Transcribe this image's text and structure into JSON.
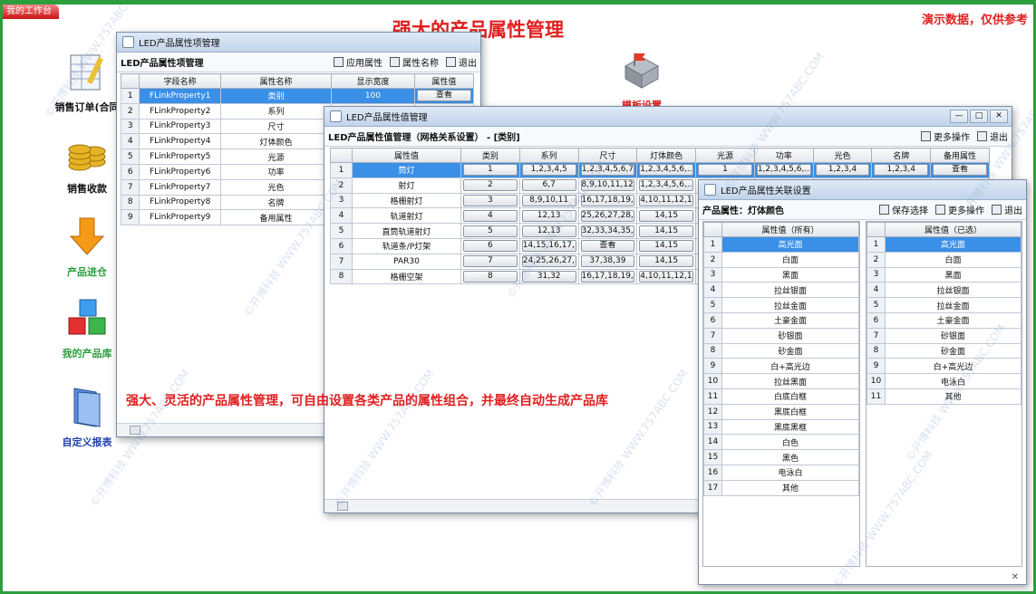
{
  "app": {
    "tab_label": "我的工作台",
    "headline": "强大的产品属性管理",
    "demo_note": "演示数据，仅供参考",
    "tagline": "强大、灵活的产品属性管理，可自由设置各类产品的属性组合，并最终自动生成产品库",
    "watermark": "©开博科技 WWW.757ABC.COM"
  },
  "sidebar": {
    "items": [
      {
        "label": "销售订单(合同",
        "icon": "spreadsheet-pencil-icon"
      },
      {
        "label": "销售收款",
        "icon": "coins-icon"
      },
      {
        "label": "产品进仓",
        "icon": "down-arrow-icon"
      },
      {
        "label": "我的产品库",
        "icon": "cubes-icon"
      },
      {
        "label": "自定义报表",
        "icon": "folder-icon"
      }
    ]
  },
  "desktop": {
    "partial_label": "模板设置",
    "icon": "flag-blocks-icon"
  },
  "win1": {
    "title": "LED产品属性项管理",
    "toolbar_label": "LED产品属性项管理",
    "actions": [
      "应用属性",
      "属性名称",
      "退出"
    ],
    "columns": [
      "字段名称",
      "属性名称",
      "显示宽度",
      "属性值"
    ],
    "rows": [
      [
        "FLinkProperty1",
        "类别",
        "100",
        "查看"
      ],
      [
        "FLinkProperty2",
        "系列",
        "",
        ""
      ],
      [
        "FLinkProperty3",
        "尺寸",
        "",
        ""
      ],
      [
        "FLinkProperty4",
        "灯体颜色",
        "",
        ""
      ],
      [
        "FLinkProperty5",
        "光源",
        "",
        ""
      ],
      [
        "FLinkProperty6",
        "功率",
        "",
        ""
      ],
      [
        "FLinkProperty7",
        "光色",
        "",
        ""
      ],
      [
        "FLinkProperty8",
        "名牌",
        "",
        ""
      ],
      [
        "FLinkProperty9",
        "备用属性",
        "",
        ""
      ]
    ]
  },
  "win2": {
    "title": "LED产品属性值管理",
    "toolbar_label": "LED产品属性值管理（网格关系设置） - [类别]",
    "actions": [
      "更多操作",
      "退出"
    ],
    "columns": [
      "属性值",
      "类别",
      "系列",
      "尺寸",
      "灯体颜色",
      "光源",
      "功率",
      "光色",
      "名牌",
      "备用属性"
    ],
    "rows": [
      [
        "筒灯",
        "1",
        "1,2,3,4,5",
        "1,2,3,4,5,6,7",
        "1,2,3,4,5,6,...",
        "1",
        "1,2,3,4,5,6,...",
        "1,2,3,4",
        "1,2,3,4",
        "查看"
      ],
      [
        "射灯",
        "2",
        "6,7",
        "8,9,10,11,12...",
        "1,2,3,4,5,6,...",
        "",
        "",
        "",
        "",
        ""
      ],
      [
        "格栅射灯",
        "3",
        "8,9,10,11",
        "16,17,18,19,...",
        "4,10,11,12,1...",
        "",
        "",
        "",
        "",
        ""
      ],
      [
        "轨道射灯",
        "4",
        "12,13",
        "25,26,27,28,...",
        "14,15",
        "",
        "",
        "",
        "",
        ""
      ],
      [
        "直筒轨道射灯",
        "5",
        "12,13",
        "32,33,34,35,36",
        "14,15",
        "",
        "",
        "",
        "",
        ""
      ],
      [
        "轨道条/P灯架",
        "6",
        "14,15,16,17,...",
        "查看",
        "14,15",
        "",
        "",
        "",
        "",
        ""
      ],
      [
        "PAR30",
        "7",
        "24,25,26,27,...",
        "37,38,39",
        "14,15",
        "",
        "",
        "",
        "",
        ""
      ],
      [
        "格栅空架",
        "8",
        "31,32",
        "16,17,18,19,...",
        "4,10,11,12,1...",
        "",
        "",
        "",
        "",
        ""
      ]
    ]
  },
  "win3": {
    "title": "LED产品属性关联设置",
    "toolbar_label": "产品属性：灯体颜色",
    "actions": [
      "保存选择",
      "更多操作",
      "退出"
    ],
    "all_header": "属性值（所有）",
    "selected_header": "属性值（已选）",
    "all_values": [
      "高光面",
      "白面",
      "黑面",
      "拉丝银面",
      "拉丝金面",
      "土豪金面",
      "砂银面",
      "砂金面",
      "白+高光边",
      "拉丝黑面",
      "白底白框",
      "黑底白框",
      "黑底黑框",
      "白色",
      "黑色",
      "电泳白",
      "其他"
    ],
    "selected_values": [
      "高光面",
      "白面",
      "黑面",
      "拉丝银面",
      "拉丝金面",
      "土豪金面",
      "砂银面",
      "砂金面",
      "白+高光边",
      "电泳白",
      "其他"
    ]
  },
  "colors": {
    "frame": "#2c9e3e",
    "accent": "#e02020",
    "selection": "#3a8fe6"
  }
}
